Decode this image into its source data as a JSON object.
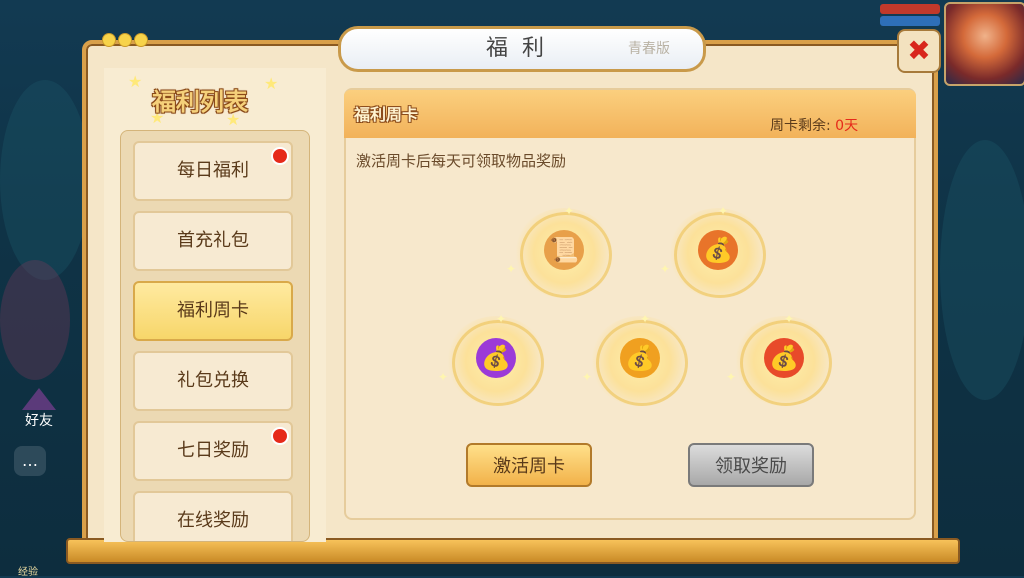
{
  "window": {
    "title": "福利",
    "title_stamp": "青春版"
  },
  "left_panel": {
    "title": "福利列表",
    "items": [
      {
        "label": "每日福利",
        "badge": true,
        "active": false
      },
      {
        "label": "首充礼包",
        "badge": false,
        "active": false
      },
      {
        "label": "福利周卡",
        "badge": false,
        "active": true
      },
      {
        "label": "礼包兑换",
        "badge": false,
        "active": false
      },
      {
        "label": "七日奖励",
        "badge": true,
        "active": false
      },
      {
        "label": "在线奖励",
        "badge": false,
        "active": false
      }
    ]
  },
  "weekly_card": {
    "section_title": "福利周卡",
    "remaining_label": "周卡剩余:",
    "remaining_value": "0天",
    "description": "激活周卡后每天可领取物品奖励",
    "rewards": [
      {
        "icon": "scroll-icon",
        "color": "#e8a04a"
      },
      {
        "icon": "treasure-bag-icon",
        "color": "#e8742a"
      },
      {
        "icon": "treasure-bag-icon",
        "color": "#9b3ad8"
      },
      {
        "icon": "treasure-bag-icon",
        "color": "#f0a020"
      },
      {
        "icon": "treasure-bag-icon",
        "color": "#e84a2a"
      }
    ],
    "activate_button": "激活周卡",
    "claim_button": "领取奖励"
  },
  "hud": {
    "friend_label": "好友",
    "exp_label": "经验"
  }
}
